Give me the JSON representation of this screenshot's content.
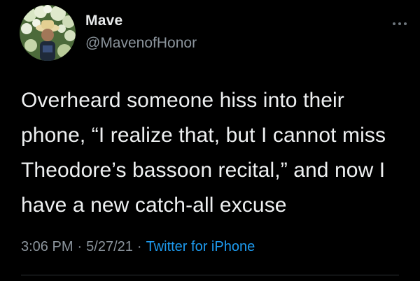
{
  "tweet": {
    "display_name": "Mave",
    "handle": "@MavenofHonor",
    "more_icon": "ellipsis-icon",
    "avatar_icon": "profile-photo-flowers",
    "text": "Overheard someone hiss into their\nphone, “I realize that, but I cannot miss\nTheodore’s bassoon recital,” and now I\nhave a new catch-all excuse",
    "time": "3:06 PM",
    "date": "5/27/21",
    "separator": "·",
    "source": "Twitter for iPhone"
  },
  "colors": {
    "background": "#000000",
    "text": "#e7e9ea",
    "secondary_text": "#8b949c",
    "link": "#1d9bf0"
  }
}
